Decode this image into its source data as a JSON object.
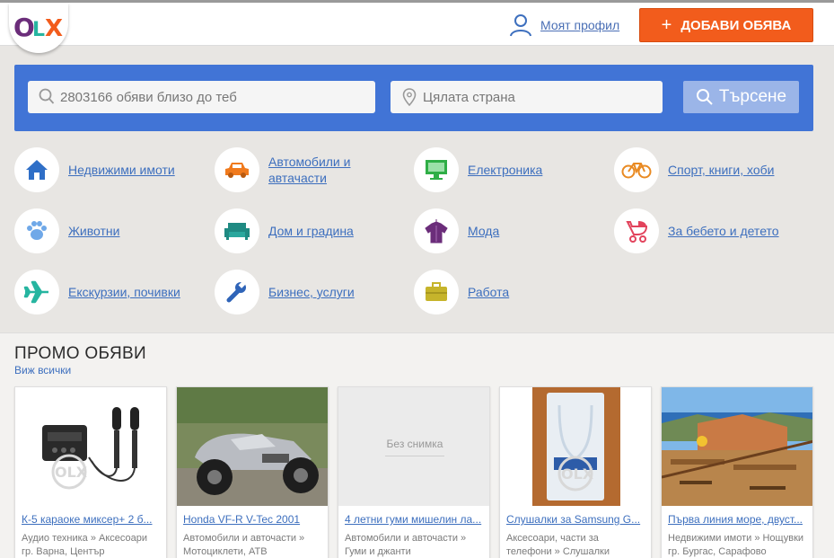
{
  "header": {
    "logo_text": "OLX",
    "profile_label": "Моят профил",
    "add_button_label": "ДОБАВИ ОБЯВА",
    "add_button_icon": "plus-icon"
  },
  "search": {
    "query_placeholder": "2803166 обяви близо до теб",
    "location_placeholder": "Цялата страна",
    "button_label": "Търсене"
  },
  "categories": [
    {
      "label": "Недвижими имоти",
      "icon": "house-icon",
      "color": "#2f6fc7"
    },
    {
      "label": "Автомобили и автачасти",
      "icon": "car-icon",
      "color": "#f07a1d"
    },
    {
      "label": "Електроника",
      "icon": "monitor-icon",
      "color": "#2fae46"
    },
    {
      "label": "Спорт, книги, хоби",
      "icon": "bicycle-icon",
      "color": "#e98a22"
    },
    {
      "label": "Животни",
      "icon": "paw-icon",
      "color": "#6fa8e8"
    },
    {
      "label": "Дом и градина",
      "icon": "sofa-icon",
      "color": "#1f8a82"
    },
    {
      "label": "Мода",
      "icon": "shirt-icon",
      "color": "#6b2d7a"
    },
    {
      "label": "За бебето и детето",
      "icon": "stroller-icon",
      "color": "#e2435c"
    },
    {
      "label": "Екскурзии, почивки",
      "icon": "airplane-icon",
      "color": "#26b5a0"
    },
    {
      "label": "Бизнес, услуги",
      "icon": "wrench-icon",
      "color": "#2f64b8"
    },
    {
      "label": "Работа",
      "icon": "briefcase-icon",
      "color": "#c6b42b"
    }
  ],
  "promo": {
    "title": "ПРОМО ОБЯВИ",
    "view_all": "Виж всички",
    "no_image_text": "Без снимка",
    "items": [
      {
        "title": "К-5 караоке миксер+ 2 б...",
        "meta1": "Аудио техника » Аксесоари",
        "meta2": "гр. Варна, Център"
      },
      {
        "title": "Honda VF-R V-Tec 2001",
        "meta1": "Автомобили и авточасти »",
        "meta2": "Мотоциклети, АТВ"
      },
      {
        "title": "4 летни гуми мишелин ла...",
        "meta1": "Автомобили и авточасти »",
        "meta2": "Гуми и джанти"
      },
      {
        "title": "Слушалки за Samsung G...",
        "meta1": "Аксесоари, части за",
        "meta2": "телефони » Слушалки"
      },
      {
        "title": "Първа линия море, двуст...",
        "meta1": "Недвижими имоти » Нощувки",
        "meta2": "гр. Бургас, Сарафово"
      }
    ]
  }
}
